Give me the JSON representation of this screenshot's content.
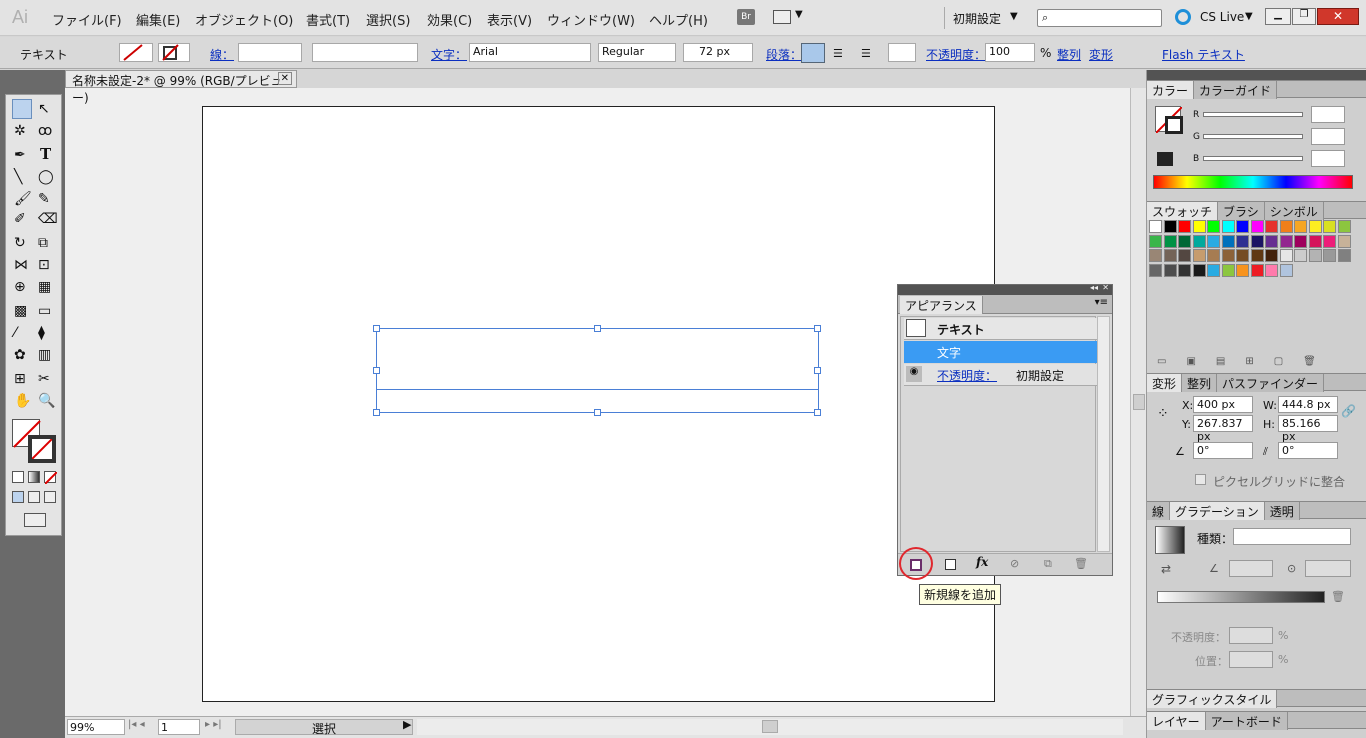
{
  "menubar": {
    "logo": "Ai",
    "items": [
      "ファイル(F)",
      "編集(E)",
      "オブジェクト(O)",
      "書式(T)",
      "選択(S)",
      "効果(C)",
      "表示(V)",
      "ウィンドウ(W)",
      "ヘルプ(H)"
    ],
    "bridge": "Br",
    "workspace": "初期設定",
    "cslive": "CS Live"
  },
  "options": {
    "mode": "テキスト",
    "stroke_label": "線：",
    "char_label": "文字：",
    "font": "Arial",
    "style": "Regular",
    "size": "72 px",
    "para_label": "段落：",
    "opacity_label": "不透明度：",
    "opacity": "100",
    "percent": "%",
    "align_label": "整列",
    "transform_label": "変形",
    "flash_label": "Flash テキスト"
  },
  "document": {
    "tab": "名称未設定-2* @ 99% (RGB/プレビュー)",
    "zoom": "99%",
    "page": "1",
    "status": "選択"
  },
  "color_panel": {
    "tabs": [
      "カラー",
      "カラーガイド"
    ],
    "r": "R",
    "g": "G",
    "b": "B"
  },
  "swatches": {
    "tabs": [
      "スウォッチ",
      "ブラシ",
      "シンボル"
    ],
    "colors": [
      "#ffffff",
      "#000000",
      "#ff0000",
      "#ffff00",
      "#00ff00",
      "#00ffff",
      "#0000ff",
      "#ff00ff",
      "#e5322d",
      "#ef7f1a",
      "#f5a623",
      "#fcee21",
      "#d9e021",
      "#8cc63f",
      "#39b54a",
      "#009245",
      "#006837",
      "#00a99d",
      "#29abe2",
      "#0071bc",
      "#2e3192",
      "#1b1464",
      "#662d91",
      "#93278f",
      "#9e005d",
      "#d4145a",
      "#ed1e79",
      "#c7b299",
      "#998675",
      "#736357",
      "#534741",
      "#c69c6d",
      "#a67c52",
      "#8c6239",
      "#754c24",
      "#603813",
      "#42210b",
      "#e6e6e6",
      "#cccccc",
      "#b3b3b3",
      "#999999",
      "#808080",
      "#666666",
      "#4d4d4d",
      "#333333",
      "#1a1a1a",
      "#29abe2",
      "#8cc63f",
      "#f7931e",
      "#ed1c24",
      "#ff7bac",
      "#b0c4de"
    ]
  },
  "transform": {
    "tabs": [
      "変形",
      "整列",
      "パスファインダー"
    ],
    "x_label": "X:",
    "x": "400 px",
    "y_label": "Y:",
    "y": "267.837 px",
    "w_label": "W:",
    "w": "444.8 px",
    "h_label": "H:",
    "h": "85.166 px",
    "rot": "0°",
    "shear": "0°",
    "pixel_grid": "ピクセルグリッドに整合"
  },
  "gradient": {
    "tabs": [
      "線",
      "グラデーション",
      "透明"
    ],
    "type_label": "種類：",
    "opacity_label": "不透明度：",
    "position_label": "位置：",
    "percent": "%"
  },
  "graphic_styles": {
    "tab": "グラフィックスタイル"
  },
  "layers": {
    "tabs": [
      "レイヤー",
      "アートボード"
    ]
  },
  "appearance": {
    "tab": "アピアランス",
    "rows": [
      "テキスト",
      "文字"
    ],
    "opacity_label": "不透明度：",
    "opacity_value": "初期設定",
    "tooltip": "新規線を追加"
  }
}
